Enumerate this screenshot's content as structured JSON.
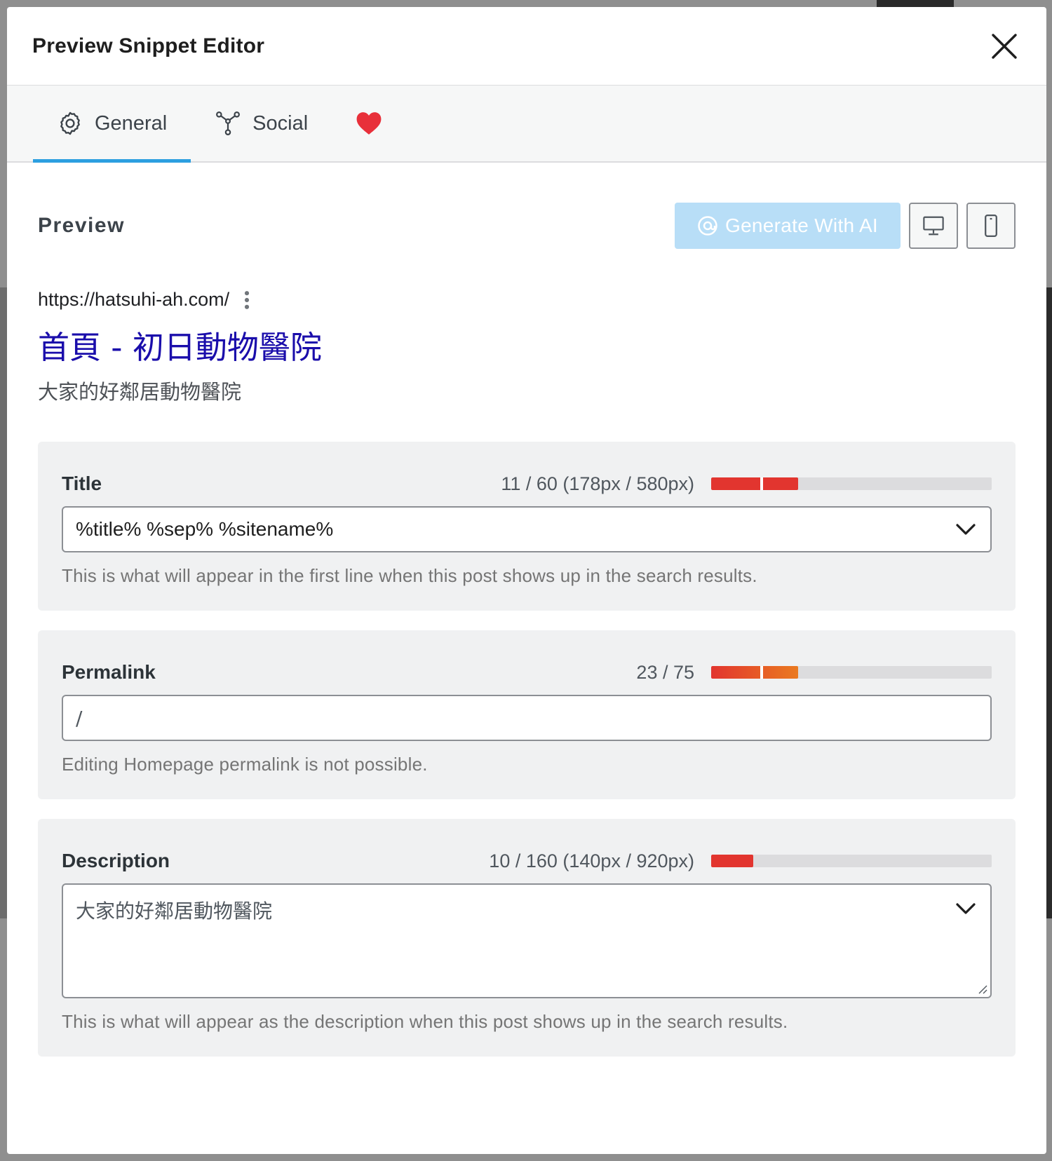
{
  "modal": {
    "title": "Preview Snippet Editor"
  },
  "tabs": [
    {
      "label": "General",
      "icon": "gear-icon",
      "active": true
    },
    {
      "label": "Social",
      "icon": "share-nodes-icon",
      "active": false
    },
    {
      "label": "",
      "icon": "heart-icon",
      "active": false
    }
  ],
  "preview": {
    "heading": "Preview",
    "ai_button_label": "Generate With AI",
    "serp": {
      "url": "https://hatsuhi-ah.com/",
      "title": "首頁 - 初日動物醫院",
      "description": "大家的好鄰居動物醫院"
    }
  },
  "fields": {
    "title": {
      "label": "Title",
      "meter_text": "11 / 60 (178px / 580px)",
      "meter_percent": 31,
      "meter_color": "#e2352f",
      "value": "%title% %sep% %sitename%",
      "help": "This is what will appear in the first line when this post shows up in the search results."
    },
    "permalink": {
      "label": "Permalink",
      "meter_text": "23 / 75",
      "meter_percent": 31,
      "meter_color": "#ea7a20",
      "value": "/",
      "help": "Editing Homepage permalink is not possible."
    },
    "description": {
      "label": "Description",
      "meter_text": "10 / 160 (140px / 920px)",
      "meter_percent": 15,
      "meter_color": "#e2352f",
      "value": "大家的好鄰居動物醫院",
      "help": "This is what will appear as the description when this post shows up in the search results."
    }
  },
  "colors": {
    "accent": "#2c9fe0",
    "serp_link": "#1a0dab",
    "heart": "#e8303a"
  }
}
